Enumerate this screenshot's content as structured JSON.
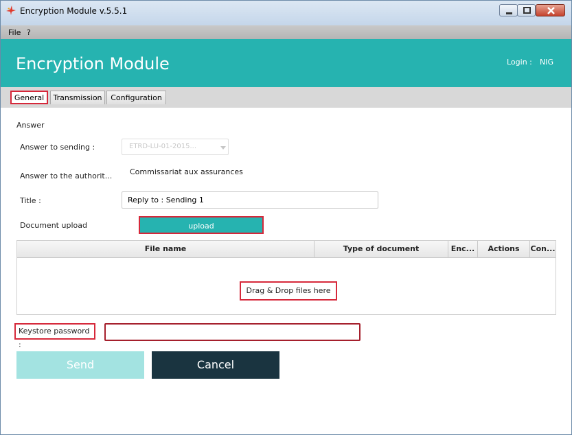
{
  "window": {
    "title": "Encryption Module v.5.5.1"
  },
  "menu": {
    "file": "File",
    "help": "?"
  },
  "header": {
    "title": "Encryption Module",
    "login_label": "Login :",
    "login_user": "NIG",
    "bg_color": "#26b3b0"
  },
  "tabs": [
    {
      "label": "General",
      "active": true
    },
    {
      "label": "Transmission",
      "active": false
    },
    {
      "label": "Configuration",
      "active": false
    }
  ],
  "form": {
    "section_title": "Answer",
    "answer_to_sending_label": "Answer to sending :",
    "answer_to_sending_value": "ETRD-LU-01-2015...",
    "answer_to_authority_label": "Answer to the authorit...",
    "answer_to_authority_value": "Commissariat aux assurances",
    "title_label": "Title :",
    "title_value": "Reply to :  Sending 1",
    "document_upload_label": "Document upload",
    "upload_button": "upload"
  },
  "table": {
    "columns": [
      "File name",
      "Type of document",
      "Enc...",
      "Actions",
      "Con..."
    ],
    "empty_text": "Drag & Drop files here"
  },
  "keystore": {
    "label": "Keystore password :",
    "value": ""
  },
  "actions": {
    "send": "Send",
    "cancel": "Cancel"
  },
  "colors": {
    "accent": "#26b3b0",
    "send_disabled": "#a3e3e1",
    "cancel": "#1a3440",
    "highlight": "#d6283a"
  }
}
